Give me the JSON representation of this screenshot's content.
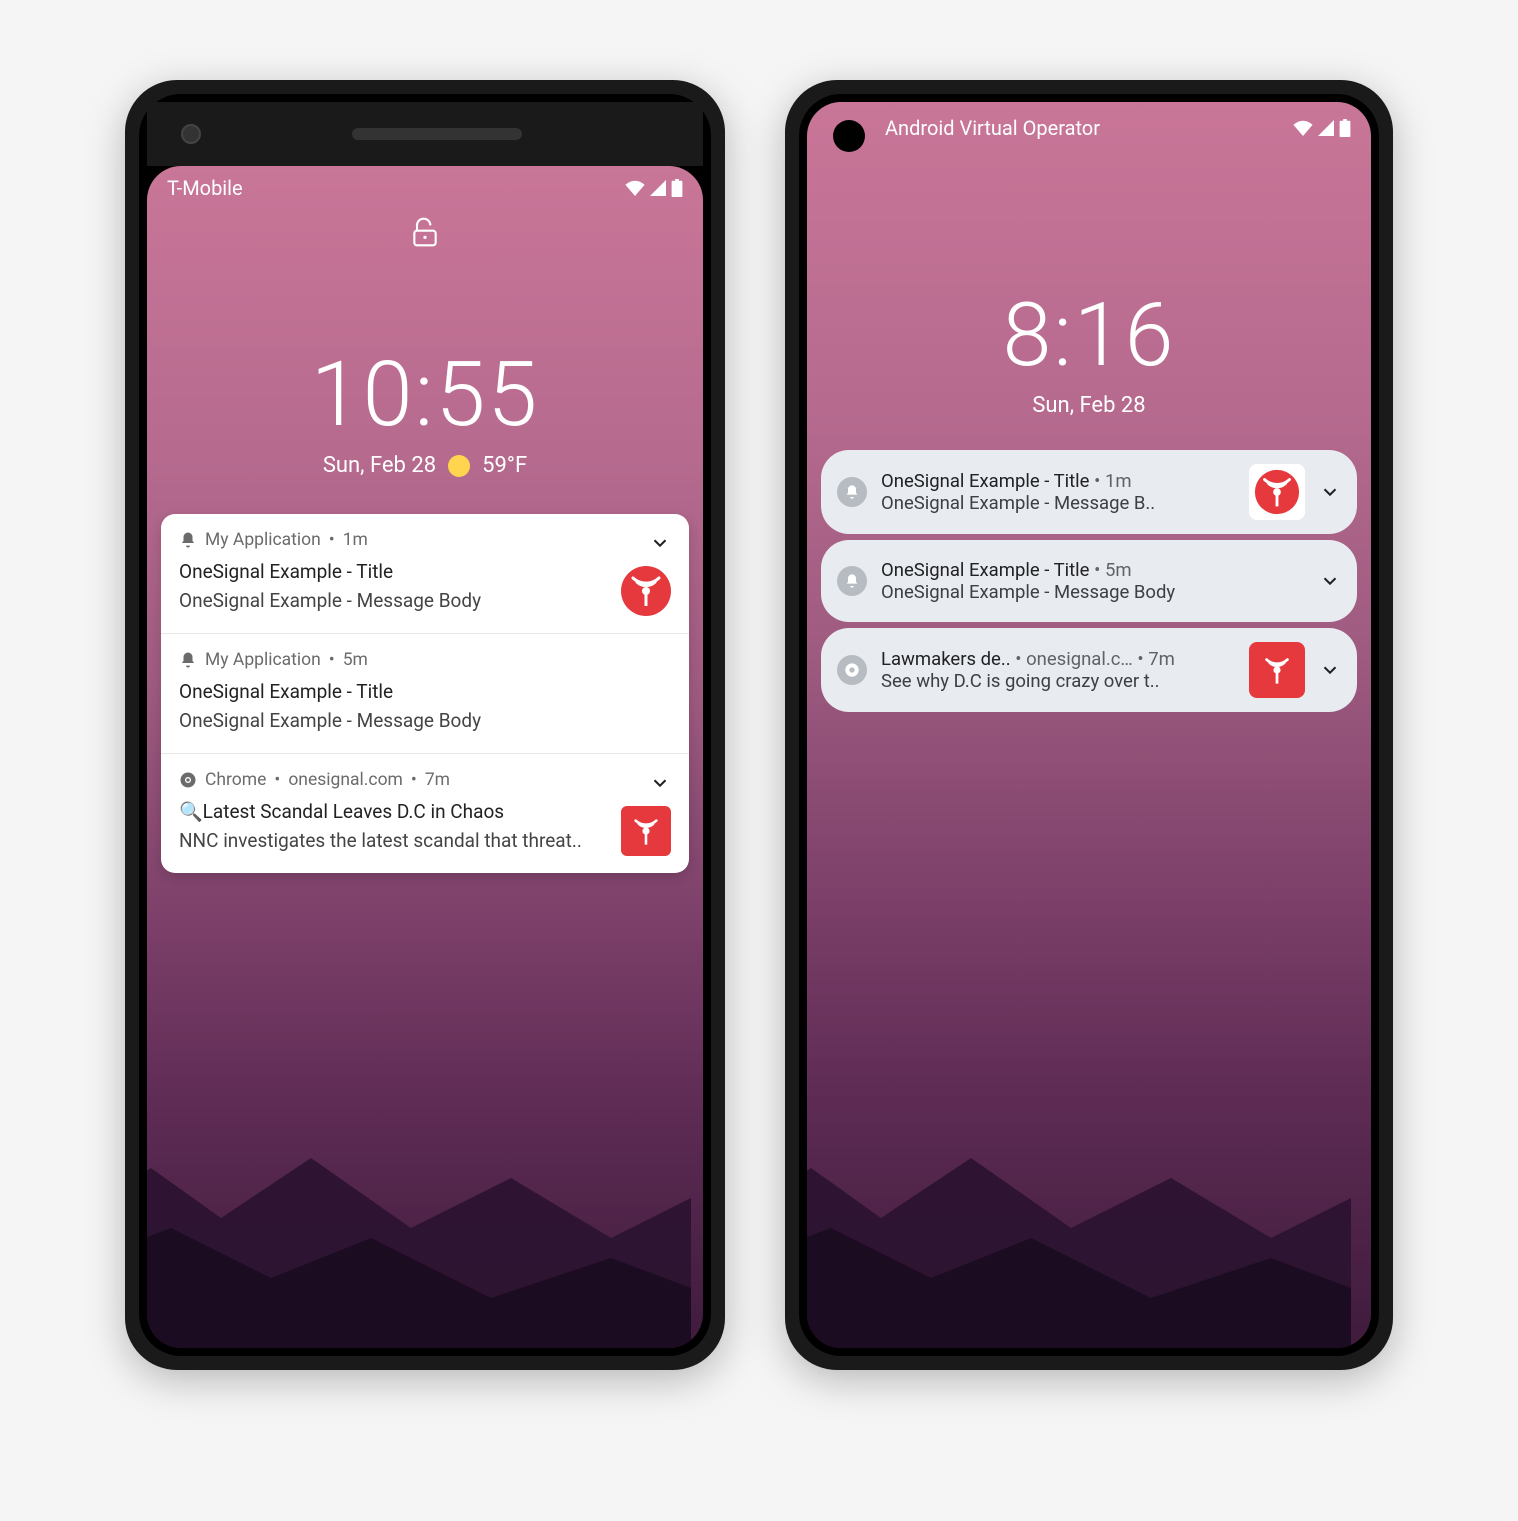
{
  "colors": {
    "accent": "#e5393d"
  },
  "left": {
    "carrier": "T-Mobile",
    "clock": "10:55",
    "date": "Sun, Feb 28",
    "temp": "59°F",
    "notifs": [
      {
        "app": "My Application",
        "time": "1m",
        "title": "OneSignal Example - Title",
        "body": "OneSignal Example - Message Body",
        "icon": "bell",
        "thumb": "onesignal-round"
      },
      {
        "app": "My Application",
        "time": "5m",
        "title": "OneSignal Example - Title",
        "body": "OneSignal Example - Message Body",
        "icon": "bell",
        "thumb": "none"
      },
      {
        "app": "Chrome",
        "site": "onesignal.com",
        "time": "7m",
        "title": "🔍Latest Scandal Leaves D.C in Chaos",
        "body": "NNC investigates the latest scandal that threat..",
        "icon": "chrome",
        "thumb": "onesignal-square"
      }
    ]
  },
  "right": {
    "carrier": "Android Virtual Operator",
    "clock": "8:16",
    "date": "Sun, Feb 28",
    "notifs": [
      {
        "titleMeta": "OneSignal Example - Title",
        "time": "1m",
        "body": "OneSignal Example - Message B..",
        "icon": "bell",
        "thumb": "onesignal-white"
      },
      {
        "titleMeta": "OneSignal Example - Title",
        "time": "5m",
        "body": "OneSignal Example - Message Body",
        "icon": "bell",
        "thumb": "none"
      },
      {
        "titleMeta": "Lawmakers de..",
        "site": "onesignal.c…",
        "time": "7m",
        "body": "See why D.C is going crazy over t..",
        "icon": "chrome",
        "thumb": "onesignal-red"
      }
    ]
  }
}
